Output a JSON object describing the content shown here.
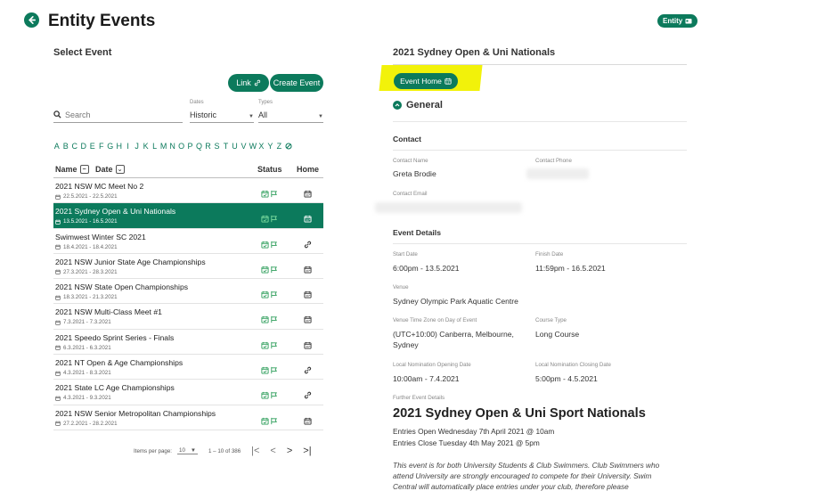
{
  "header": {
    "title": "Entity Events",
    "entity_badge": "Entity"
  },
  "left": {
    "title": "Select Event",
    "link_label": "Link",
    "create_label": "Create Event",
    "search_placeholder": "Search",
    "dates_label": "Dates",
    "dates_value": "Historic",
    "types_label": "Types",
    "types_value": "All",
    "alphabet": [
      "A",
      "B",
      "C",
      "D",
      "E",
      "F",
      "G",
      "H",
      "I",
      "J",
      "K",
      "L",
      "M",
      "N",
      "O",
      "P",
      "Q",
      "R",
      "S",
      "T",
      "U",
      "V",
      "W",
      "X",
      "Y",
      "Z"
    ],
    "col_name": "Name",
    "col_date": "Date",
    "col_status": "Status",
    "col_home": "Home",
    "events": [
      {
        "name": "2021 NSW MC Meet No 2",
        "dates": "22.5.2021 - 22.5.2021",
        "home": "calendar"
      },
      {
        "name": "2021 Sydney Open & Uni Nationals",
        "dates": "13.5.2021 - 16.5.2021",
        "home": "calendar",
        "active": true
      },
      {
        "name": "Swimwest Winter SC 2021",
        "dates": "18.4.2021 - 18.4.2021",
        "home": "link"
      },
      {
        "name": "2021 NSW Junior State Age Championships",
        "dates": "27.3.2021 - 28.3.2021",
        "home": "calendar"
      },
      {
        "name": "2021 NSW State Open Championships",
        "dates": "18.3.2021 - 21.3.2021",
        "home": "calendar"
      },
      {
        "name": "2021 NSW Multi-Class Meet #1",
        "dates": "7.3.2021 - 7.3.2021",
        "home": "calendar"
      },
      {
        "name": "2021 Speedo Sprint Series - Finals",
        "dates": "6.3.2021 - 6.3.2021",
        "home": "calendar"
      },
      {
        "name": "2021 NT Open & Age Championships",
        "dates": "4.3.2021 - 8.3.2021",
        "home": "link"
      },
      {
        "name": "2021 State LC Age Championships",
        "dates": "4.3.2021 - 9.3.2021",
        "home": "link"
      },
      {
        "name": "2021 NSW Senior Metropolitan Championships",
        "dates": "27.2.2021 - 28.2.2021",
        "home": "calendar"
      }
    ],
    "pager": {
      "items_per_page_label": "Items per page:",
      "items_per_page": "10",
      "range": "1 – 10 of 386"
    }
  },
  "right": {
    "event_title": "2021 Sydney Open & Uni Nationals",
    "event_home_label": "Event Home",
    "general_label": "General",
    "contact_title": "Contact",
    "contact_name_label": "Contact Name",
    "contact_name": "Greta Brodie",
    "contact_phone_label": "Contact Phone",
    "contact_email_label": "Contact Email",
    "details_title": "Event Details",
    "start_label": "Start Date",
    "start_value": "6:00pm - 13.5.2021",
    "finish_label": "Finish Date",
    "finish_value": "11:59pm - 16.5.2021",
    "venue_label": "Venue",
    "venue_value": "Sydney Olympic Park Aquatic Centre",
    "tz_label": "Venue Time Zone on Day of Event",
    "tz_value": "(UTC+10:00) Canberra, Melbourne, Sydney",
    "course_label": "Course Type",
    "course_value": "Long Course",
    "nom_open_label": "Local Nomination Opening Date",
    "nom_open_value": "10:00am - 7.4.2021",
    "nom_close_label": "Local Nomination Closing Date",
    "nom_close_value": "5:00pm - 4.5.2021",
    "further_label": "Further Event Details",
    "big_title": "2021 Sydney Open & Uni Sport Nationals",
    "entries_open": "Entries Open Wednesday 7th April 2021 @ 10am",
    "entries_close": "Entries Close Tuesday 4th May 2021 @ 5pm",
    "paragraph": "This event is for both University Students & Club Swimmers. Club Swimmers who attend University are strongly encouraged to compete for their University. Swim Central will automatically place entries under your club, therefore please"
  },
  "colors": {
    "accent": "#0c7a5c",
    "highlight": "#f2f20a"
  }
}
